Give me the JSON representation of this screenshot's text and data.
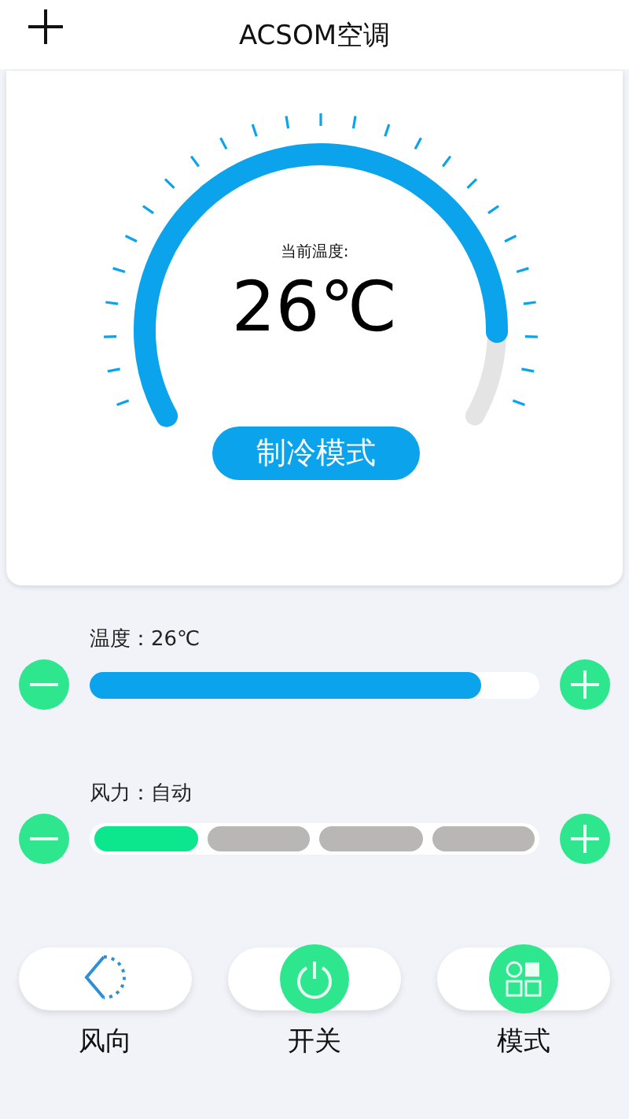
{
  "header": {
    "title": "ACSOM空调"
  },
  "gauge": {
    "caption": "当前温度:",
    "reading": "26℃",
    "mode_button": "制冷模式"
  },
  "temperature": {
    "label": "温度：26℃",
    "level": 0.87
  },
  "wind": {
    "label": "风力：自动",
    "segments": [
      {
        "on": true
      },
      {
        "on": false
      },
      {
        "on": false
      },
      {
        "on": false
      }
    ]
  },
  "controls": [
    {
      "kind": "direction",
      "label": "风向"
    },
    {
      "kind": "power",
      "label": "开关"
    },
    {
      "kind": "mode",
      "label": "模式"
    }
  ]
}
